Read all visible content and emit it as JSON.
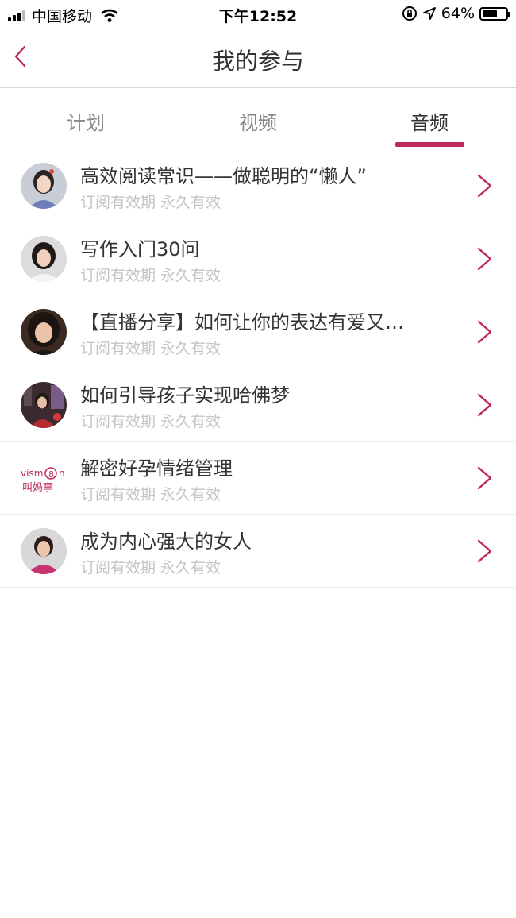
{
  "status_bar": {
    "carrier": "中国移动",
    "time": "下午12:52",
    "battery": "64%",
    "battery_level": 0.64
  },
  "nav": {
    "title": "我的参与",
    "accent": "#c0285a"
  },
  "tabs": [
    {
      "label": "计划",
      "active": false
    },
    {
      "label": "视频",
      "active": false
    },
    {
      "label": "音频",
      "active": true
    }
  ],
  "items": [
    {
      "title": "高效阅读常识——做聪明的“懒人”",
      "subtitle": "订阅有效期 永久有效",
      "avatar": "woman-portrait-blue"
    },
    {
      "title": "写作入门30问",
      "subtitle": "订阅有效期 永久有效",
      "avatar": "woman-portrait-white"
    },
    {
      "title": "【直播分享】如何让你的表达有爱又…",
      "subtitle": "订阅有效期 永久有效",
      "avatar": "woman-portrait-dark"
    },
    {
      "title": "如何引导孩子实现哈佛梦",
      "subtitle": "订阅有效期 永久有效",
      "avatar": "woman-portrait-red"
    },
    {
      "title": "解密好孕情绪管理",
      "subtitle": "订阅有效期 永久有效",
      "avatar": "logo",
      "avatar_text": [
        "vism",
        "8",
        "n",
        "叫妈享"
      ]
    },
    {
      "title": "成为内心强大的女人",
      "subtitle": "订阅有效期 永久有效",
      "avatar": "woman-portrait-pink"
    }
  ]
}
